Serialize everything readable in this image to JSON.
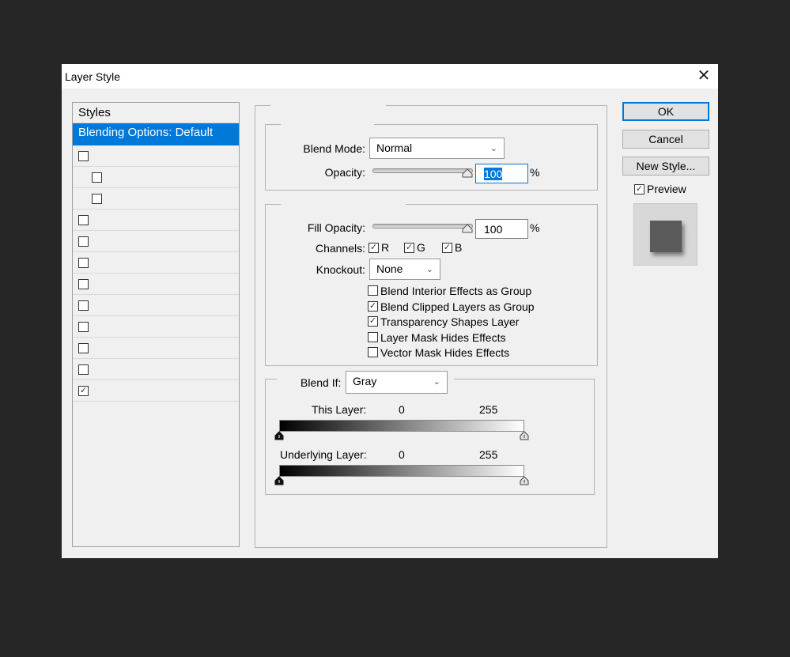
{
  "window": {
    "title": "Layer Style",
    "close_glyph": "✕"
  },
  "styles_panel": {
    "header": "Styles",
    "selected_item": "Blending Options: Default",
    "items": [
      {
        "checked": false,
        "indent": false
      },
      {
        "checked": false,
        "indent": true
      },
      {
        "checked": false,
        "indent": true
      },
      {
        "checked": false,
        "indent": false
      },
      {
        "checked": false,
        "indent": false
      },
      {
        "checked": false,
        "indent": false
      },
      {
        "checked": false,
        "indent": false
      },
      {
        "checked": false,
        "indent": false
      },
      {
        "checked": false,
        "indent": false
      },
      {
        "checked": false,
        "indent": false
      },
      {
        "checked": false,
        "indent": false
      },
      {
        "checked": true,
        "indent": false
      }
    ]
  },
  "general_blending": {
    "blend_mode_label": "Blend Mode:",
    "blend_mode_value": "Normal",
    "opacity_label": "Opacity:",
    "opacity_value": "100",
    "percent": "%"
  },
  "advanced_blending": {
    "fill_opacity_label": "Fill Opacity:",
    "fill_opacity_value": "100",
    "percent": "%",
    "channels_label": "Channels:",
    "channels": [
      {
        "name": "R",
        "checked": true
      },
      {
        "name": "G",
        "checked": true
      },
      {
        "name": "B",
        "checked": true
      }
    ],
    "knockout_label": "Knockout:",
    "knockout_value": "None",
    "options": [
      {
        "label": "Blend Interior Effects as Group",
        "checked": false
      },
      {
        "label": "Blend Clipped Layers as Group",
        "checked": true
      },
      {
        "label": "Transparency Shapes Layer",
        "checked": true
      },
      {
        "label": "Layer Mask Hides Effects",
        "checked": false
      },
      {
        "label": "Vector Mask Hides Effects",
        "checked": false
      }
    ]
  },
  "blend_if": {
    "label": "Blend If:",
    "value": "Gray",
    "this_layer_label": "This Layer:",
    "this_layer_min": "0",
    "this_layer_max": "255",
    "underlying_label": "Underlying Layer:",
    "underlying_min": "0",
    "underlying_max": "255"
  },
  "buttons": {
    "ok": "OK",
    "cancel": "Cancel",
    "new_style": "New Style...",
    "preview_label": "Preview",
    "preview_checked": true
  },
  "icons": {
    "check_glyph": "✓",
    "chevron_glyph": "⌄"
  }
}
